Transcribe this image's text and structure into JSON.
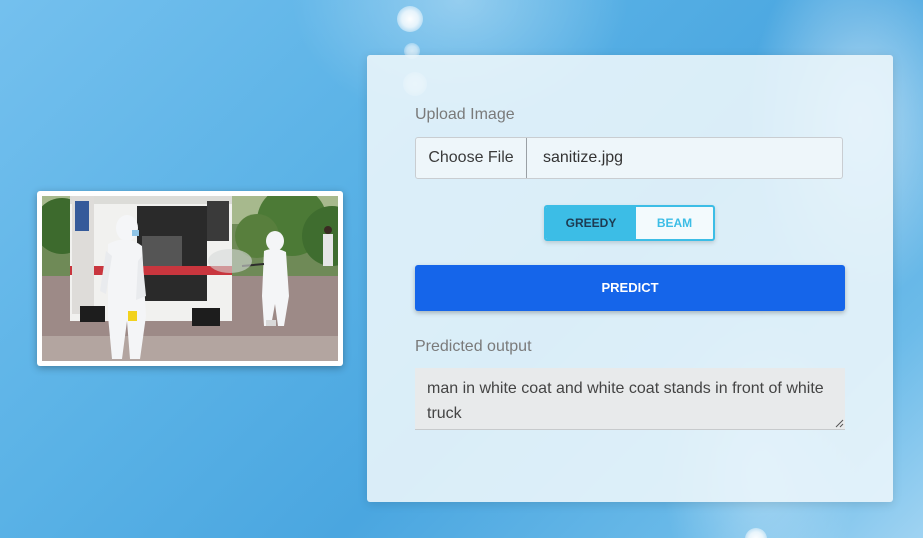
{
  "form": {
    "upload_label": "Upload Image",
    "choose_file_label": "Choose File",
    "file_name": "sanitize.jpg",
    "decoding_options": [
      {
        "label": "GREEDY",
        "selected": true
      },
      {
        "label": "BEAM",
        "selected": false
      }
    ],
    "predict_label": "PREDICT",
    "output_label": "Predicted output",
    "output_text": "man in white coat and white coat stands in front of white truck"
  },
  "colors": {
    "accent": "#3cbde6",
    "primary_button": "#1565ea",
    "panel_background": "#eaf5fb",
    "output_background": "#e8eaeb"
  },
  "icons": {
    "resize_grip": "resize-grip-icon"
  }
}
